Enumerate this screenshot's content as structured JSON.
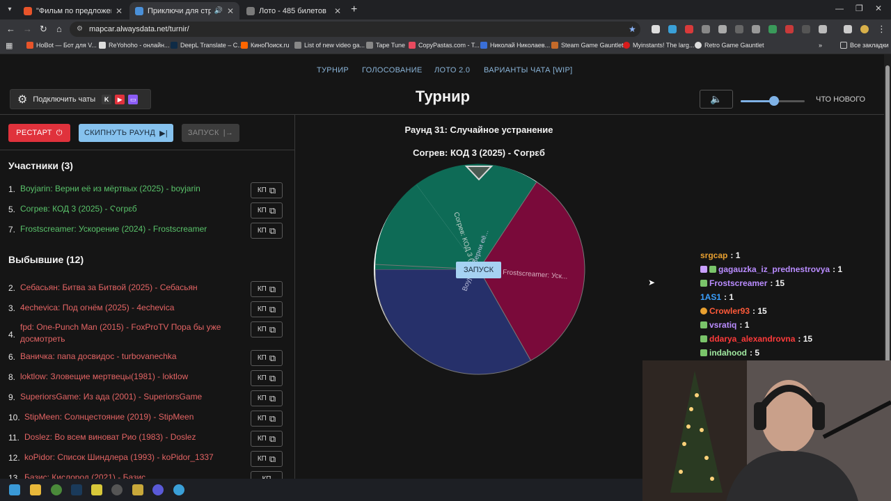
{
  "browser": {
    "tabs": [
      {
        "title": "\"Фильм по предложениям от ",
        "active": false,
        "favicon_color": "#e8542a"
      },
      {
        "title": "Приключи для стрима",
        "active": true,
        "favicon_color": "#4a90d9"
      },
      {
        "title": "Лото - 485 билетов",
        "active": false,
        "favicon_color": "#7a7a7a"
      }
    ],
    "url": "mapcar.alwaysdata.net/turnir/",
    "bookmarks": [
      {
        "label": "HoBot — Бот для V...",
        "color": "#e8542a"
      },
      {
        "label": "ReYohoho - онлайн...",
        "color": "#dddddd"
      },
      {
        "label": "DeepL Translate – C...",
        "color": "#0f2b46"
      },
      {
        "label": "КиноПоиск.ru",
        "color": "#ff6600"
      },
      {
        "label": "List of new video ga...",
        "color": "#888888"
      },
      {
        "label": "Tape Tune",
        "color": "#888888"
      },
      {
        "label": "CopyPastas.com - T...",
        "color": "#e84a5f"
      },
      {
        "label": "Николай Николаев...",
        "color": "#3a6fd8"
      },
      {
        "label": "Steam Game Gauntlet",
        "color": "#c46a2a"
      },
      {
        "label": "Myinstants! The larg...",
        "color": "#d81b1b"
      },
      {
        "label": "Retro Game Gauntlet",
        "color": "#dddddd"
      }
    ],
    "all_bookmarks": "Все закладки"
  },
  "app": {
    "nav": [
      "ТУРНИР",
      "ГОЛОСОВАНИЕ",
      "ЛОТО 2.0",
      "ВАРИАНТЫ ЧАТА [WIP]"
    ],
    "connect_label": "Подключить чаты",
    "title": "Турнир",
    "whats_new": "ЧТО НОВОГО",
    "volume_fraction": 0.5,
    "buttons": {
      "restart": "РЕСТАРТ",
      "skip": "СКИПНУТЬ РАУНД",
      "launch": "ЗАПУСК"
    },
    "participants_header": "Участники (3)",
    "participants": [
      {
        "num": "1.",
        "text": "Boyjarin: Верни её из мёртвых (2025) - boyjarin"
      },
      {
        "num": "5.",
        "text": "Согрев: КОД 3 (2025) - Ϛогрɛб"
      },
      {
        "num": "7.",
        "text": "Frostscreamer: Ускорение (2024) - Frostscreamer"
      }
    ],
    "eliminated_header": "Выбывшие (12)",
    "eliminated": [
      {
        "num": "2.",
        "text": "Себасьян: Битва за Битвой (2025) - Себасьян"
      },
      {
        "num": "3.",
        "text": "4echevica: Под огнём (2025) - 4echevica"
      },
      {
        "num": "4.",
        "text": "fpd: One-Punch Man (2015) - FoxProTV Пора бы уже досмотреть"
      },
      {
        "num": "6.",
        "text": "Ваничка: папа досвидос - turbovanechka"
      },
      {
        "num": "8.",
        "text": "loktlow: Зловещие мертвецы(1981) - loktlow"
      },
      {
        "num": "9.",
        "text": "SuperiorsGame: Из ада (2001) - SuperiorsGame"
      },
      {
        "num": "10.",
        "text": "StipMeen: Солнцестояние (2019) - StipMeen"
      },
      {
        "num": "11.",
        "text": "Doslez: Во всем виноват Рио (1983) - Doslez"
      },
      {
        "num": "12.",
        "text": "koPidor: Список Шиндлера (1993) - koPidor_1337"
      },
      {
        "num": "13.",
        "text": "Базис: Кислород (2021) - Базис"
      }
    ],
    "kp_label": "КП",
    "round_title": "Раунд 31: Случайное устранение",
    "round_sub": "Согрев: КОД 3 (2025) - Ϛогрɛб",
    "spin_label": "ЗАПУСК",
    "wheel": [
      {
        "label": "Согрев: КОД 3 (202...",
        "color": "#0e6b56"
      },
      {
        "label": "Frostscreamer: Уск...",
        "color": "#7a0a3a"
      },
      {
        "label": "Boyjarin: Верни её...",
        "color": "#26306a"
      }
    ]
  },
  "chat": [
    {
      "user": "srgcap",
      "count": "1",
      "color": "#e8a030",
      "icon": ""
    },
    {
      "user": "gagauzka_iz_prednestrovya",
      "count": "1",
      "color": "#b98cff",
      "icon": "#c9a0ff"
    },
    {
      "user": "Frostscreamer",
      "count": "15",
      "color": "#b98cff",
      "icon": "#7ac46a"
    },
    {
      "user": "1AS1",
      "count": "1",
      "color": "#3aa0ff",
      "icon": ""
    },
    {
      "user": "Crowler93",
      "count": "15",
      "color": "#ff5a3a",
      "icon": "#e8a030"
    },
    {
      "user": "vsratiq",
      "count": "1",
      "color": "#b98cff",
      "icon": "#7ac46a"
    },
    {
      "user": "ddarya_alexandrovna",
      "count": "15",
      "color": "#ff3a3a",
      "icon": "#7ac46a"
    },
    {
      "user": "indahood",
      "count": "5",
      "color": "#a0e8a0",
      "icon": "#7ac46a"
    }
  ]
}
